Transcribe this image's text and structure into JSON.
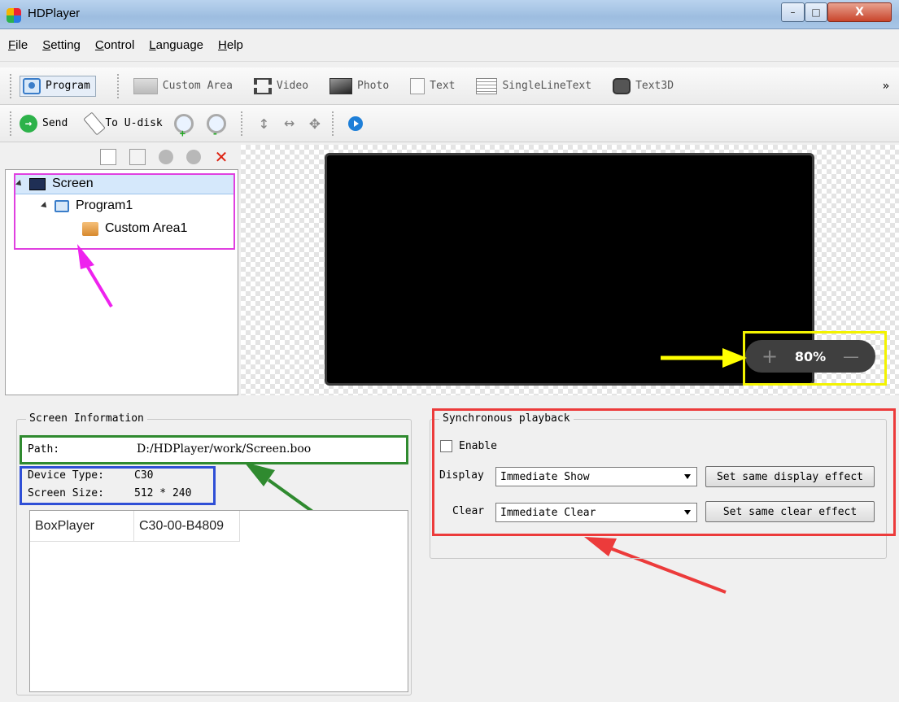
{
  "window": {
    "title": "HDPlayer",
    "min_glyph": "–",
    "max_glyph": "□",
    "close_glyph": "X"
  },
  "menu": [
    {
      "label_u": "F",
      "label_rest": "ile"
    },
    {
      "label_u": "S",
      "label_rest": "etting"
    },
    {
      "label_u": "C",
      "label_rest": "ontrol"
    },
    {
      "label_u": "L",
      "label_rest": "anguage"
    },
    {
      "label_u": "H",
      "label_rest": "elp"
    }
  ],
  "toolbar1": {
    "items": [
      "Program",
      "Custom Area",
      "Video",
      "Photo",
      "Text",
      "SingleLineText",
      "Text3D"
    ],
    "overflow": "»"
  },
  "toolbar2": {
    "send": "Send",
    "to_udisk": "To U-disk"
  },
  "tree": {
    "root": "Screen",
    "program": "Program1",
    "area": "Custom Area1"
  },
  "zoom": {
    "plus": "+",
    "value": "80%",
    "minus": "—"
  },
  "screen_info": {
    "title": "Screen Information",
    "path_label": "Path:",
    "path_value": "D:/HDPlayer/work/Screen.boo",
    "device_type_label": "Device Type:",
    "device_type_value": "C30",
    "screen_size_label": "Screen Size:",
    "screen_size_value": "512 * 240",
    "player_name": "BoxPlayer",
    "player_id": "C30-00-B4809"
  },
  "sync": {
    "title": "Synchronous playback",
    "enable_label": "Enable",
    "display_label": "Display",
    "display_value": "Immediate Show",
    "display_button": "Set same display effect",
    "clear_label": "Clear",
    "clear_value": "Immediate Clear",
    "clear_button": "Set same clear effect"
  },
  "colors": {
    "tree_highlight": "#e040e0",
    "zoom_highlight": "#f3f300",
    "path_highlight": "#2f8a2f",
    "device_highlight": "#2f4fd6",
    "sync_highlight": "#ec3b3b"
  }
}
